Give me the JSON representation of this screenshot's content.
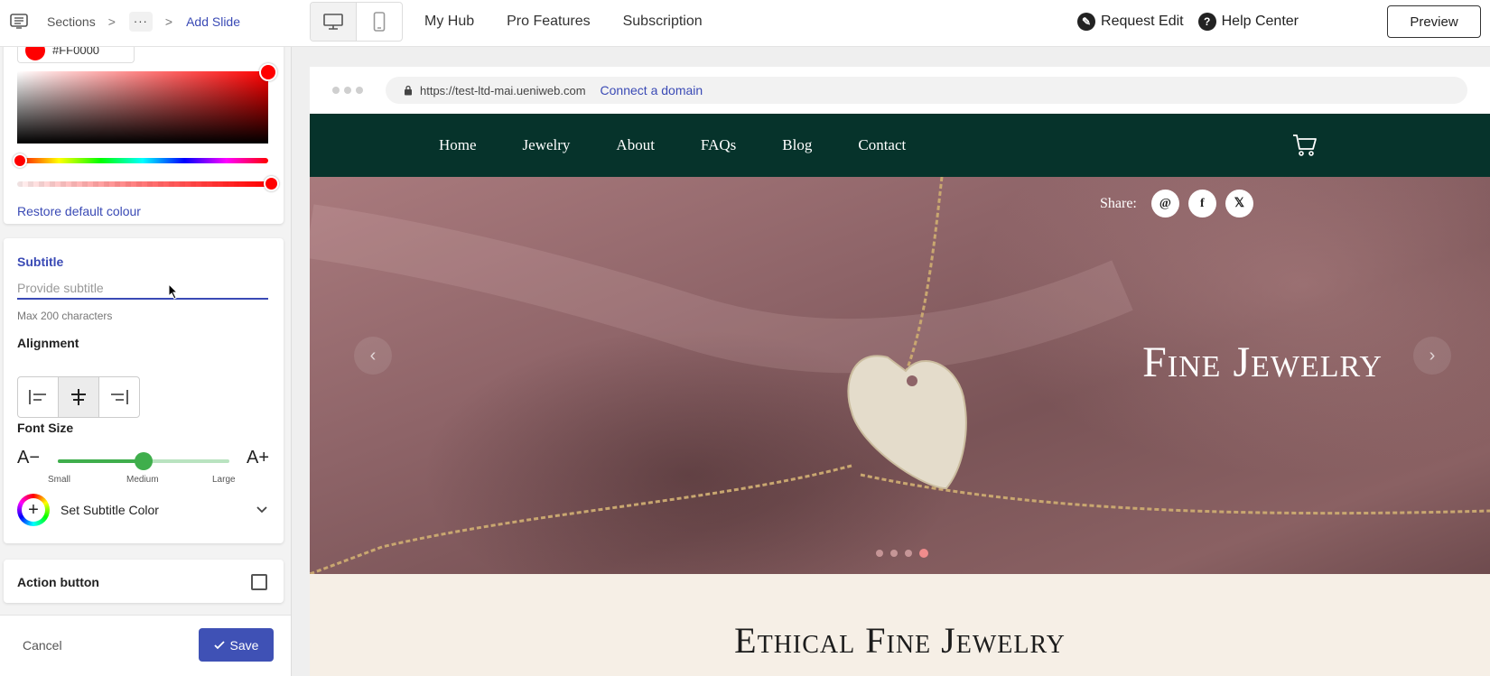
{
  "breadcrumb": {
    "sections": "Sections",
    "more": "···",
    "current": "Add Slide"
  },
  "topnav": {
    "items": [
      "My Hub",
      "Pro Features",
      "Subscription"
    ]
  },
  "actions": {
    "request_edit": "Request Edit",
    "help_center": "Help Center",
    "preview": "Preview"
  },
  "color_picker": {
    "hex": "#FF0000",
    "restore": "Restore default colour",
    "color": "#ff0000"
  },
  "subtitle": {
    "label": "Subtitle",
    "placeholder": "Provide subtitle",
    "value": "",
    "hint": "Max 200 characters"
  },
  "alignment": {
    "label": "Alignment",
    "selected": "center"
  },
  "font_size": {
    "label": "Font Size",
    "decrease": "A−",
    "increase": "A+",
    "small": "Small",
    "medium": "Medium",
    "large": "Large",
    "value": 0.5
  },
  "subtitle_color": {
    "label": "Set Subtitle Color"
  },
  "action_button": {
    "label": "Action button",
    "checked": false
  },
  "footer": {
    "cancel": "Cancel",
    "save": "Save"
  },
  "browser": {
    "url": "https://test-ltd-mai.ueniweb.com",
    "connect": "Connect a domain"
  },
  "site": {
    "nav": [
      "Home",
      "Jewelry",
      "About",
      "FAQs",
      "Blog",
      "Contact"
    ],
    "share_label": "Share:",
    "hero_title": "Fine Jewelry",
    "section_title": "Ethical Fine Jewelry",
    "active_slide": 4,
    "slide_count": 4,
    "nav_bg": "#06332b",
    "section_bg": "#f6efe6"
  }
}
